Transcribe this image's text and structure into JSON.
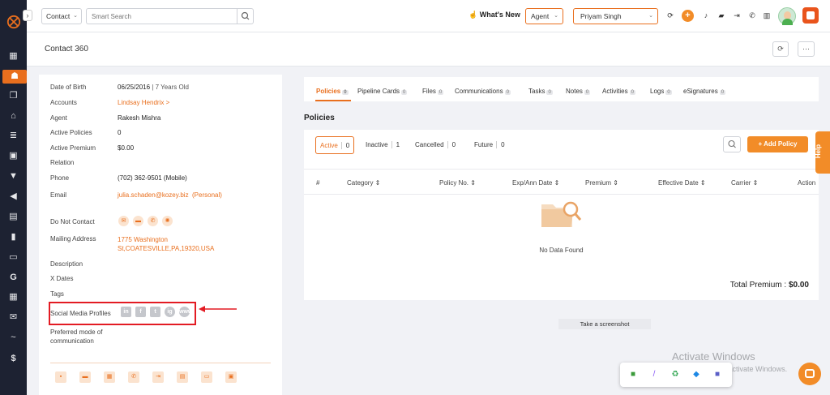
{
  "nav": {
    "icons": [
      "dashboard-icon",
      "contacts-icon",
      "documents-icon",
      "bank-icon",
      "list-icon",
      "profile-card-icon",
      "filter-icon",
      "megaphone-icon",
      "reports-icon",
      "analytics-icon",
      "folder-icon",
      "google-icon",
      "calendar-icon",
      "mail-icon",
      "signature-icon",
      "dollar-icon"
    ],
    "active_index": 1
  },
  "topbar": {
    "contact_select": "Contact",
    "search_placeholder": "Smart Search",
    "whats_new": "What's New",
    "agent_select": "Agent",
    "user_select": "Priyam Singh"
  },
  "page": {
    "title": "Contact 360"
  },
  "details": {
    "dob_label": "Date of Birth",
    "dob_value": "06/25/2016",
    "dob_age": "| 7 Years Old",
    "accounts_label": "Accounts",
    "accounts_value": "Lindsay Hendrix >",
    "agent_label": "Agent",
    "agent_value": "Rakesh Mishra",
    "active_policies_label": "Active Policies",
    "active_policies_value": "0",
    "active_premium_label": "Active Premium",
    "active_premium_value": "$0.00",
    "relation_label": "Relation",
    "phone_label": "Phone",
    "phone_value": "(702) 362-9501 (Mobile)",
    "email_label": "Email",
    "email_value": "julia.schaden@kozey.biz  (Personal)",
    "dnc_label": "Do Not Contact",
    "mailing_label": "Mailing Address",
    "mailing_line1": "1775 Washington",
    "mailing_line2": "St,COATESVILLE,PA,19320,USA",
    "description_label": "Description",
    "xdates_label": "X Dates",
    "tags_label": "Tags",
    "social_label": "Social Media Profiles",
    "social_icons": [
      "in",
      "f",
      "t",
      "ig",
      "www"
    ],
    "preferred_label_1": "Preferred mode of",
    "preferred_label_2": "communication"
  },
  "tabs": [
    {
      "label": "Policies",
      "count": "0"
    },
    {
      "label": "Pipeline Cards",
      "count": "0"
    },
    {
      "label": "Files",
      "count": "0"
    },
    {
      "label": "Communications",
      "count": "0"
    },
    {
      "label": "Tasks",
      "count": "0"
    },
    {
      "label": "Notes",
      "count": "0"
    },
    {
      "label": "Activities",
      "count": "0"
    },
    {
      "label": "Logs",
      "count": "0"
    },
    {
      "label": "eSignatures",
      "count": "0"
    }
  ],
  "policies": {
    "heading": "Policies",
    "filters": [
      {
        "label": "Active",
        "count": "0"
      },
      {
        "label": "Inactive",
        "count": "1"
      },
      {
        "label": "Cancelled",
        "count": "0"
      },
      {
        "label": "Future",
        "count": "0"
      }
    ],
    "add_button": "+ Add Policy",
    "columns": [
      "#",
      "Category ⇕",
      "Policy No. ⇕",
      "Exp/Ann Date ⇕",
      "Premium ⇕",
      "Effective Date ⇕",
      "Carrier ⇕",
      "Action"
    ],
    "empty_text": "No Data Found",
    "total_label": "Total Premium :",
    "total_value": "$0.00"
  },
  "screenshot_tip": "Take a screenshot",
  "help": "Help",
  "watermark": {
    "line1": "Activate Windows",
    "line2": "Go to Settings to activate Windows."
  },
  "colors": {
    "accent": "#e96f1e",
    "nav_bg": "#1d2232",
    "highlight": "#e31b23"
  }
}
